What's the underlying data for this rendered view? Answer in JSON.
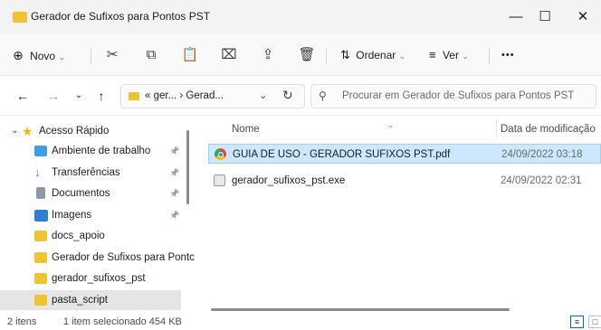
{
  "window": {
    "title": "Gerador de Sufixos  para Pontos PST",
    "minimize": "—",
    "maximize": "☐",
    "close": "✕"
  },
  "toolbar": {
    "new_label": "Novo",
    "sort_label": "Ordenar",
    "view_label": "Ver",
    "more_label": "•••",
    "icons": [
      "plus-circle-icon",
      "cut-icon",
      "copy-icon",
      "paste-icon",
      "rename-icon",
      "share-icon",
      "delete-icon",
      "sort-icon",
      "view-icon"
    ]
  },
  "address": {
    "path": "« ger... › Gerad...",
    "search_placeholder": "Procurar em Gerador de Sufixos  para Pontos PST"
  },
  "sidebar": {
    "header": "Acesso Rápido",
    "items": [
      {
        "label": "Ambiente de trabalho",
        "icon": "desktop-icon",
        "pinned": true,
        "color": "#3aa0e6"
      },
      {
        "label": "Transferências",
        "icon": "download-icon",
        "pinned": true,
        "color": "#1f7fd6"
      },
      {
        "label": "Documentos",
        "icon": "document-icon",
        "pinned": true,
        "color": "#8c9aa8"
      },
      {
        "label": "Imagens",
        "icon": "image-icon",
        "pinned": true,
        "color": "#2c7fd1"
      },
      {
        "label": "docs_apoio",
        "icon": "folder-icon",
        "pinned": false,
        "color": "#f1c232"
      },
      {
        "label": "Gerador de Sufixos  para Pontc",
        "icon": "folder-icon",
        "pinned": false,
        "color": "#f1c232"
      },
      {
        "label": "gerador_sufixos_pst",
        "icon": "folder-icon",
        "pinned": false,
        "color": "#f1c232"
      },
      {
        "label": "pasta_script",
        "icon": "folder-icon",
        "pinned": false,
        "color": "#f1c232",
        "selected": true
      }
    ]
  },
  "content": {
    "columns": {
      "name": "Nome",
      "modified": "Data de modificação"
    },
    "files": [
      {
        "name": "GUIA DE USO - GERADOR SUFIXOS PST.pdf",
        "date": "24/09/2022 03:18",
        "icon": "chrome-pdf-icon",
        "selected": true
      },
      {
        "name": "gerador_sufixos_pst.exe",
        "date": "24/09/2022 02:31",
        "icon": "exe-icon",
        "selected": false
      }
    ]
  },
  "status": {
    "count": "2 itens",
    "selection": "1 item selecionado 454 KB"
  },
  "colors": {
    "accent": "#0067c0",
    "selection": "#cce8ff",
    "folder": "#f1c232",
    "star": "#f4b400"
  }
}
